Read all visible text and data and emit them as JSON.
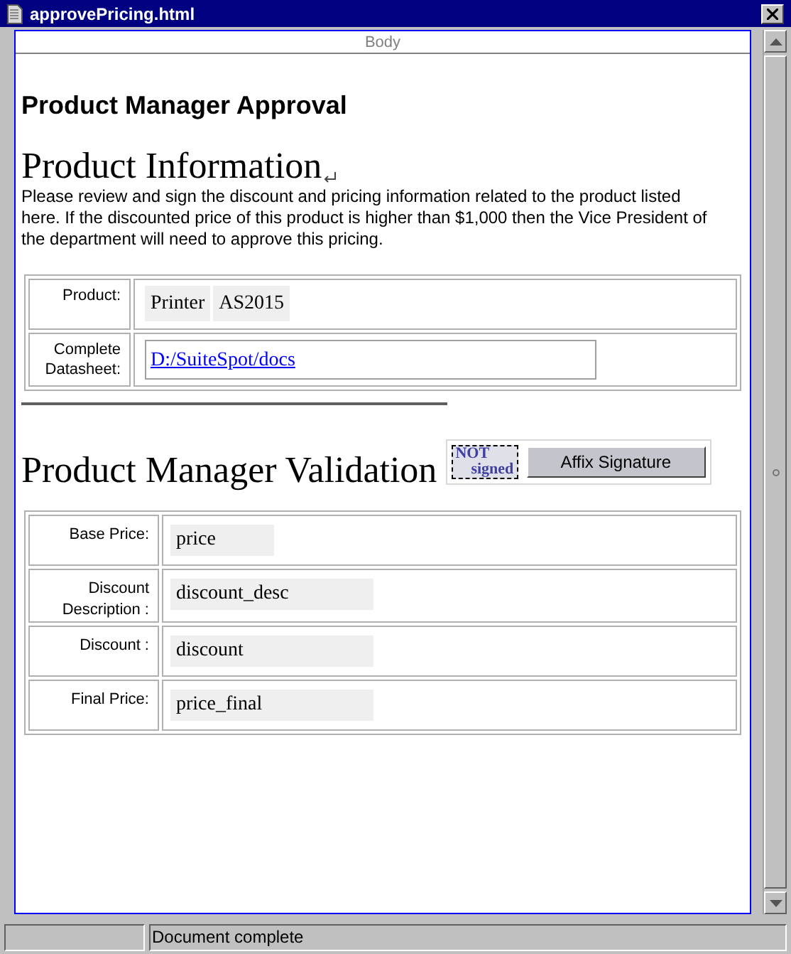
{
  "window": {
    "title": "approvePricing.html"
  },
  "body_label": "Body",
  "heading": "Product Manager Approval",
  "product_info": {
    "title": "Product Information",
    "intro": "Please review and sign the discount and pricing information related to the product listed here. If the discounted price of this product is higher than $1,000 then the Vice President of the department will need to approve this pricing.",
    "rows": [
      {
        "label": "Product:",
        "kind": "values",
        "values": [
          "Printer",
          "AS2015"
        ]
      },
      {
        "label": "Complete Datasheet:",
        "kind": "link",
        "link": "D:/SuiteSpot/docs"
      }
    ]
  },
  "validation": {
    "title": "Product Manager Validation",
    "stamp": [
      "NOT",
      "signed"
    ],
    "button": "Affix Signature",
    "rows": [
      {
        "label": "Base Price:",
        "value": "price",
        "wide": false
      },
      {
        "label": "Discount Description :",
        "value": "discount_desc",
        "wide": true
      },
      {
        "label": "Discount :",
        "value": "discount",
        "wide": true
      },
      {
        "label": "Final Price:",
        "value": "price_final",
        "wide": true
      }
    ]
  },
  "status_bar": {
    "message": "Document complete"
  }
}
